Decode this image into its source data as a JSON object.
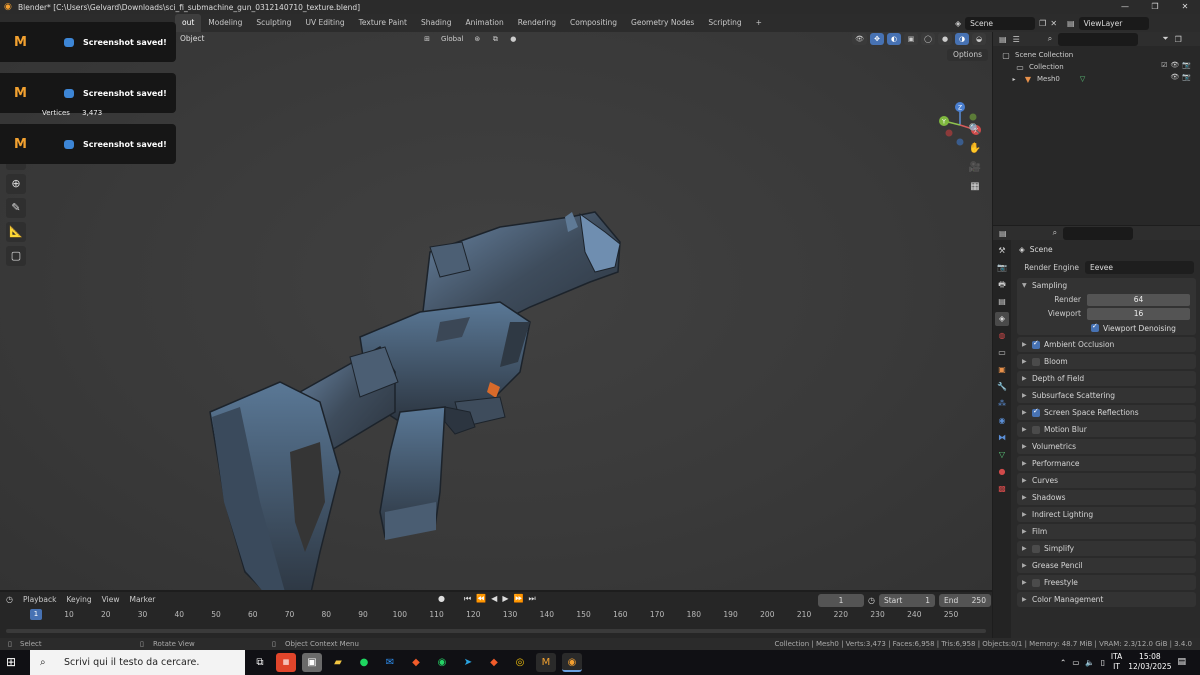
{
  "window": {
    "title": "Blender* [C:\\Users\\Gelvard\\Downloads\\sci_fi_submachine_gun_0312140710_texture.blend]",
    "controls": [
      "—",
      "❐",
      "✕"
    ]
  },
  "workspaces": [
    "out",
    "Modeling",
    "Sculpting",
    "UV Editing",
    "Texture Paint",
    "Shading",
    "Animation",
    "Rendering",
    "Compositing",
    "Geometry Nodes",
    "Scripting",
    "+"
  ],
  "active_workspace": "out",
  "scene_selector": {
    "scene": "Scene",
    "view_layer": "ViewLayer"
  },
  "viewport": {
    "mode_label": "Object",
    "orientation": "Global",
    "options_label": "Options",
    "overlay_stats": {
      "vertices_label": "Vertices",
      "vertices_value": "3,473"
    }
  },
  "notifications": [
    {
      "message": "Screenshot saved!"
    },
    {
      "message": "Screenshot saved!"
    },
    {
      "message": "Screenshot saved!"
    }
  ],
  "notification_logo": "M",
  "outliner": {
    "root": "Scene Collection",
    "items": [
      {
        "name": "Collection"
      },
      {
        "name": "Mesh0"
      }
    ]
  },
  "properties": {
    "context": "Scene",
    "render_engine_label": "Render Engine",
    "render_engine": "Eevee",
    "sampling": {
      "title": "Sampling",
      "render_label": "Render",
      "render_value": "64",
      "viewport_label": "Viewport",
      "viewport_value": "16",
      "denoising_label": "Viewport Denoising"
    },
    "panels": [
      {
        "label": "Ambient Occlusion",
        "checkbox": true,
        "checked": true
      },
      {
        "label": "Bloom",
        "checkbox": true,
        "checked": false
      },
      {
        "label": "Depth of Field",
        "checkbox": false
      },
      {
        "label": "Subsurface Scattering",
        "checkbox": false
      },
      {
        "label": "Screen Space Reflections",
        "checkbox": true,
        "checked": true
      },
      {
        "label": "Motion Blur",
        "checkbox": true,
        "checked": false
      },
      {
        "label": "Volumetrics",
        "checkbox": false
      },
      {
        "label": "Performance",
        "checkbox": false
      },
      {
        "label": "Curves",
        "checkbox": false
      },
      {
        "label": "Shadows",
        "checkbox": false
      },
      {
        "label": "Indirect Lighting",
        "checkbox": false
      },
      {
        "label": "Film",
        "checkbox": false
      },
      {
        "label": "Simplify",
        "checkbox": true,
        "checked": false
      },
      {
        "label": "Grease Pencil",
        "checkbox": false
      },
      {
        "label": "Freestyle",
        "checkbox": true,
        "checked": false
      },
      {
        "label": "Color Management",
        "checkbox": false
      }
    ]
  },
  "timeline": {
    "menus": [
      "Playback",
      "Keying",
      "View",
      "Marker"
    ],
    "current_frame": "1",
    "start_label": "Start",
    "start": "1",
    "end_label": "End",
    "end": "250",
    "ticks": [
      "10",
      "20",
      "30",
      "40",
      "50",
      "60",
      "70",
      "80",
      "90",
      "100",
      "110",
      "120",
      "130",
      "140",
      "150",
      "160",
      "170",
      "180",
      "190",
      "200",
      "210",
      "220",
      "230",
      "240",
      "250"
    ]
  },
  "statusbar": {
    "select": "Select",
    "rotate": "Rotate View",
    "context_menu": "Object Context Menu",
    "stats": "Collection | Mesh0 | Verts:3,473 | Faces:6,958 | Tris:6,958 | Objects:0/1 | Memory: 48.7 MiB | VRAM: 2.3/12.0 GiB | 3.4.0"
  },
  "taskbar": {
    "search_placeholder": "Scrivi qui il testo da cercare.",
    "lang_top": "ITA",
    "lang_bottom": "IT",
    "time": "15:08",
    "date": "12/03/2025"
  },
  "colors": {
    "accent": "#4772b3",
    "brand_orange": "#f2a130"
  }
}
